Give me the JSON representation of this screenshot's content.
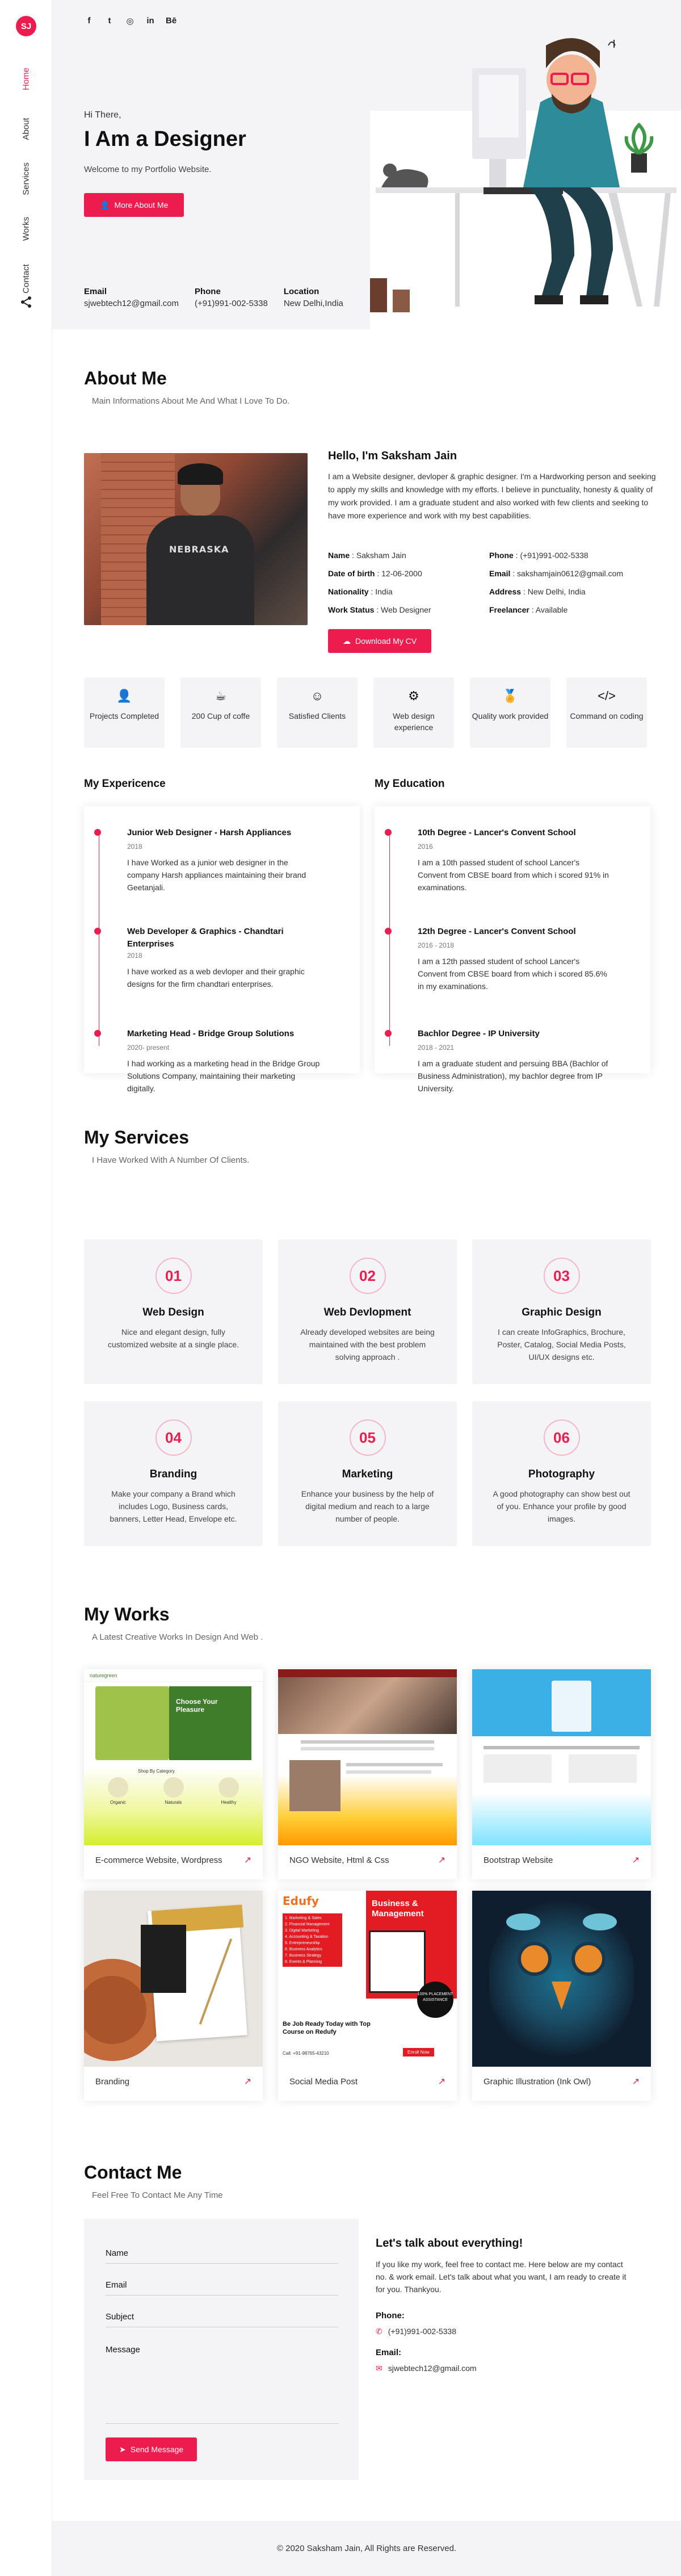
{
  "brand": {
    "initials": "SJ",
    "accent": "#ed1c4f"
  },
  "nav": {
    "items": [
      "Home",
      "About",
      "Services",
      "Works",
      "Contact"
    ],
    "active": "Home"
  },
  "social_icons": [
    "facebook-icon",
    "twitter-icon",
    "instagram-icon",
    "linkedin-icon",
    "behance-icon"
  ],
  "social_glyphs": [
    "f",
    "t",
    "◎",
    "in",
    "Bē"
  ],
  "hero": {
    "greeting": "Hi There,",
    "title": "I Am a Designer",
    "subtitle": "Welcome to my Portfolio Website.",
    "button": "More About Me",
    "info": [
      {
        "label": "Email",
        "value": "sjwebtech12@gmail.com"
      },
      {
        "label": "Phone",
        "value": "(+91)991-002-5338"
      },
      {
        "label": "Location",
        "value": "New Delhi,India"
      }
    ]
  },
  "about": {
    "title": "About Me",
    "subtitle": "Main Informations About Me And What I Love To Do.",
    "hello": "Hello, I'm Saksham Jain",
    "bio": "I am a Website designer, devloper & graphic designer. I'm a Hardworking person and seeking to apply my skills and knowledge with my efforts. I believe in punctuality, honesty & quality of my work provided. I am a graduate student and also worked with few clients and seeking to have more experience and work with my best capabilities.",
    "personal": [
      {
        "label": "Name",
        "value": "Saksham Jain"
      },
      {
        "label": "Phone",
        "value": "(+91)991-002-5338"
      },
      {
        "label": "Date of birth",
        "value": "12-06-2000"
      },
      {
        "label": "Email",
        "value": "sakshamjain0612@gmail.com"
      },
      {
        "label": "Nationality",
        "value": "India"
      },
      {
        "label": "Address",
        "value": "New Delhi, India"
      },
      {
        "label": "Work Status",
        "value": "Web Designer"
      },
      {
        "label": "Freelancer",
        "value": "Available"
      }
    ],
    "cv_button": "Download My CV",
    "stats": [
      {
        "icon": "user-icon",
        "glyph": "👤",
        "text": "Projects Completed"
      },
      {
        "icon": "coffee-icon",
        "glyph": "☕",
        "text": "200 Cup of coffe"
      },
      {
        "icon": "smile-icon",
        "glyph": "☺",
        "text": "Satisfied Clients"
      },
      {
        "icon": "gear-icon",
        "glyph": "⚙",
        "text": "Web design experience"
      },
      {
        "icon": "medal-icon",
        "glyph": "🏅",
        "text": "Quality work provided"
      },
      {
        "icon": "code-icon",
        "glyph": "</>",
        "text": "Command on coding"
      }
    ]
  },
  "experience": {
    "title": "My Expericence",
    "items": [
      {
        "head": "Junior Web Designer - Harsh Appliances",
        "date": "2018",
        "desc": "I have Worked as a junior web designer in the company Harsh appliances maintaining their brand Geetanjali."
      },
      {
        "head": "Web Developer & Graphics - Chandtari Enterprises",
        "date": "2018",
        "desc": "I have worked as a web devloper and their graphic designs for the firm chandtari enterprises."
      },
      {
        "head": "Marketing Head - Bridge Group Solutions",
        "date": "2020- present",
        "desc": "I had working as a marketing head in the Bridge Group Solutions Company, maintaining their marketing digitally."
      }
    ]
  },
  "education": {
    "title": "My Education",
    "items": [
      {
        "head": "10th Degree - Lancer's Convent School",
        "date": "2016",
        "desc": "I am a 10th passed student of school Lancer's Convent from CBSE board from which i scored 91% in examinations."
      },
      {
        "head": "12th Degree - Lancer's Convent School",
        "date": "2016 - 2018",
        "desc": "I am a 12th passed student of school Lancer's Convent from CBSE board from which i scored 85.6% in my examinations."
      },
      {
        "head": "Bachlor Degree - IP University",
        "date": "2018 - 2021",
        "desc": "I am a graduate student and persuing BBA (Bachlor of Business Administration), my bachlor degree from IP University."
      }
    ]
  },
  "services": {
    "title": "My Services",
    "subtitle": "I Have Worked With A Number Of Clients.",
    "items": [
      {
        "num": "01",
        "name": "Web Design",
        "desc": "Nice and elegant design, fully customized website at a single place."
      },
      {
        "num": "02",
        "name": "Web Devlopment",
        "desc": "Already developed websites are being maintained with the best problem solving approach ."
      },
      {
        "num": "03",
        "name": "Graphic Design",
        "desc": "I can create InfoGraphics, Brochure, Poster, Catalog, Social Media Posts, UI/UX designs etc."
      },
      {
        "num": "04",
        "name": "Branding",
        "desc": "Make your company a Brand which includes Logo, Business cards, banners, Letter Head, Envelope etc."
      },
      {
        "num": "05",
        "name": "Marketing",
        "desc": "Enhance your business by the help of digital medium and reach to a large number of people."
      },
      {
        "num": "06",
        "name": "Photography",
        "desc": "A good photography can show best out of you. Enhance your profile by good images."
      }
    ]
  },
  "works": {
    "title": "My Works",
    "subtitle": "A Latest Creative Works In Design And Web .",
    "items": [
      {
        "caption": "E-commerce Website, Wordpress"
      },
      {
        "caption": "NGO Website, Html & Css"
      },
      {
        "caption": "Bootstrap Website"
      },
      {
        "caption": "Branding"
      },
      {
        "caption": "Social Media Post"
      },
      {
        "caption": "Graphic Illustration (Ink Owl)"
      }
    ],
    "thumb_texts": {
      "ecommerce_logo": "naturegreen",
      "ecommerce_heading": "Choose Your Pleasure",
      "ecommerce_section": "Shop By Category",
      "ecommerce_cats": [
        "Organic",
        "Naturals",
        "Healthy"
      ],
      "social_brand": "Edufy",
      "social_heading": "Business & Management",
      "social_list": [
        "1. Marketing & Sales",
        "2. Financial Management",
        "3. Digital Marketing",
        "4. Accounting & Taxation",
        "5. Entrepreneurship",
        "6. Business Analytics",
        "7. Business Strategy",
        "8. Events & Planning"
      ],
      "social_cta": "Be Job Ready Today with Top Course on Redufy",
      "social_badge": "100% PLACEMENT ASSISTANCE",
      "social_phone": "Call: +91-98765-43210",
      "social_button": "Enroll Now"
    }
  },
  "contact": {
    "title": "Contact Me",
    "subtitle": "Feel Free To Contact Me Any Time",
    "fields": {
      "name": "Name",
      "email": "Email",
      "subject": "Subject",
      "message": "Message"
    },
    "send": "Send Message",
    "talk_title": "Let's talk about everything!",
    "talk_text": "If you like my work, feel free to contact me. Here below are my contact no. & work email. Let's talk about what you want, I am ready to create it for you. Thankyou.",
    "phone_label": "Phone:",
    "phone": "(+91)991-002-5338",
    "email_label": "Email:",
    "email": "sjwebtech12@gmail.com"
  },
  "footer": {
    "text": "© 2020 Saksham Jain, All Rights are Reserved."
  }
}
